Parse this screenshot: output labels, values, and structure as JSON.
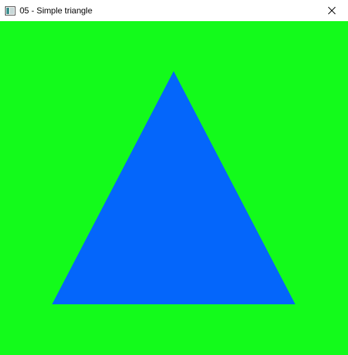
{
  "window": {
    "title": "05 - Simple triangle"
  },
  "titlebar": {
    "app_icon": "window-app-icon",
    "close_icon": "close-icon"
  },
  "canvas": {
    "background_color": "#13fb1b",
    "triangle_color": "#0466fb"
  }
}
